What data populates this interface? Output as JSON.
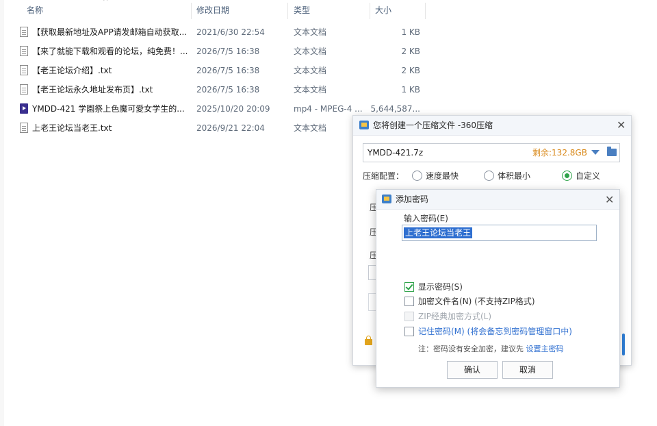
{
  "columns": {
    "name": "名称",
    "date": "修改日期",
    "type": "类型",
    "size": "大小"
  },
  "files": [
    {
      "name": "【获取最新地址及APP请发邮箱自动获取...",
      "date": "2021/6/30 22:54",
      "type": "文本文档",
      "size": "1 KB",
      "icon": "text-file-icon"
    },
    {
      "name": "【来了就能下载和观看的论坛，纯免费！...",
      "date": "2026/7/5 16:38",
      "type": "文本文档",
      "size": "2 KB",
      "icon": "text-file-icon"
    },
    {
      "name": "【老王论坛介绍】.txt",
      "date": "2026/7/5 16:38",
      "type": "文本文档",
      "size": "2 KB",
      "icon": "text-file-icon"
    },
    {
      "name": "【老王论坛永久地址发布页】.txt",
      "date": "2026/7/5 16:38",
      "type": "文本文档",
      "size": "1 KB",
      "icon": "text-file-icon"
    },
    {
      "name": "YMDD-421 学園祭上色魔可愛女学生的...",
      "date": "2025/10/20 20:09",
      "type": "mp4 - MPEG-4 ...",
      "size": "5,644,587...",
      "icon": "video-file-icon"
    },
    {
      "name": "上老王论坛当老王.txt",
      "date": "2026/9/21 22:04",
      "type": "文本文档",
      "size": "",
      "icon": "text-file-icon"
    }
  ],
  "compress_dialog": {
    "title": "您将创建一个压缩文件 -360压缩",
    "archive_name": "YMDD-421.7z",
    "free_space": "剩余:132.8GB",
    "config_label": "压缩配置：",
    "options": [
      "速度最快",
      "体积最小",
      "自定义"
    ],
    "selected_option": "自定义",
    "hidden_labels": [
      "压",
      "压",
      "压"
    ]
  },
  "password_dialog": {
    "title": "添加密码",
    "input_label": "输入密码(E)",
    "password_value": "上老王论坛当老王",
    "show_password": {
      "label": "显示密码(S)",
      "checked": true
    },
    "encrypt_filename": {
      "label": "加密文件名(N) (不支持ZIP格式)",
      "checked": false
    },
    "zip_classic": {
      "label": "ZIP经典加密方式(L)",
      "disabled": true
    },
    "remember": {
      "label": "记住密码(M) (将会备忘到密码管理窗口中)",
      "checked": false
    },
    "note_prefix": "注：密码没有安全加密，建议先",
    "note_link": "设置主密码",
    "ok_label": "确认",
    "cancel_label": "取消"
  },
  "colors": {
    "accent_green": "#2fa34a",
    "link_blue": "#2f6fd0",
    "free_space_orange": "#d98a1c",
    "selection_blue": "#2f6fd0"
  }
}
